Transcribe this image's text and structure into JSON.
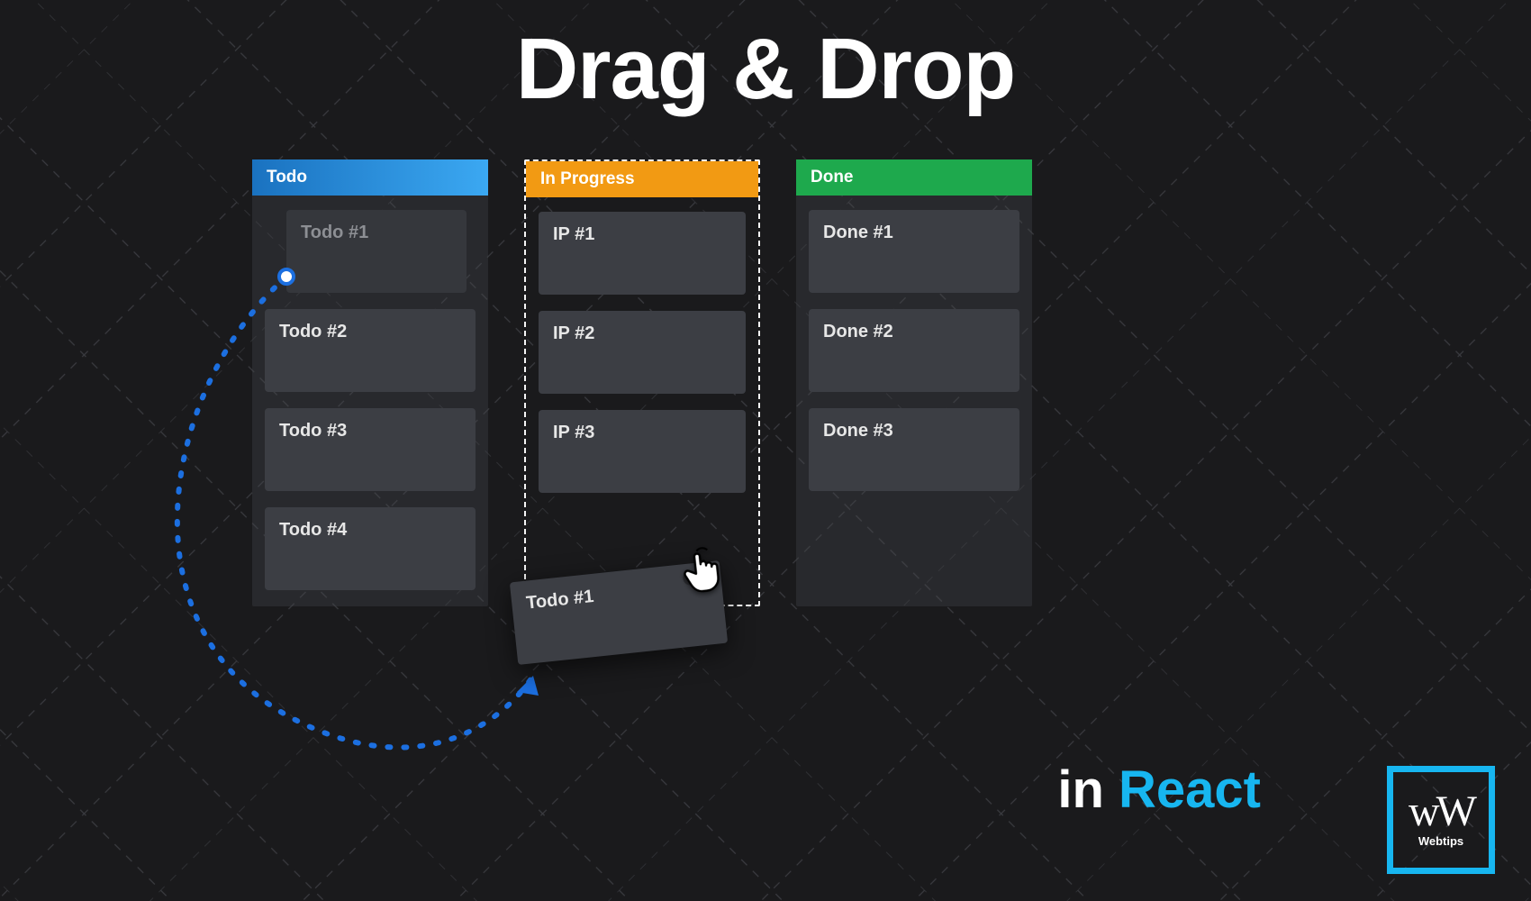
{
  "title": "Drag & Drop",
  "subtitle": {
    "prefix": "in ",
    "react": "React"
  },
  "columns": [
    {
      "label": "Todo",
      "color": "blue",
      "dropzone": false,
      "cards": [
        {
          "label": "Todo #1",
          "ghost": true
        },
        {
          "label": "Todo #2",
          "ghost": false
        },
        {
          "label": "Todo #3",
          "ghost": false
        },
        {
          "label": "Todo #4",
          "ghost": false
        }
      ]
    },
    {
      "label": "In Progress",
      "color": "orange",
      "dropzone": true,
      "cards": [
        {
          "label": "IP #1",
          "ghost": false
        },
        {
          "label": "IP #2",
          "ghost": false
        },
        {
          "label": "IP #3",
          "ghost": false
        }
      ]
    },
    {
      "label": "Done",
      "color": "green",
      "dropzone": false,
      "cards": [
        {
          "label": "Done #1",
          "ghost": false
        },
        {
          "label": "Done #2",
          "ghost": false
        },
        {
          "label": "Done #3",
          "ghost": false
        }
      ]
    }
  ],
  "dragged_card": {
    "label": "Todo #1"
  },
  "logo": {
    "mark": "wW",
    "label": "Webtips"
  },
  "colors": {
    "blue": "#2b8ddf",
    "orange": "#f29a13",
    "green": "#1ea94d",
    "accent": "#17b6f0",
    "path": "#1c6fe0"
  }
}
